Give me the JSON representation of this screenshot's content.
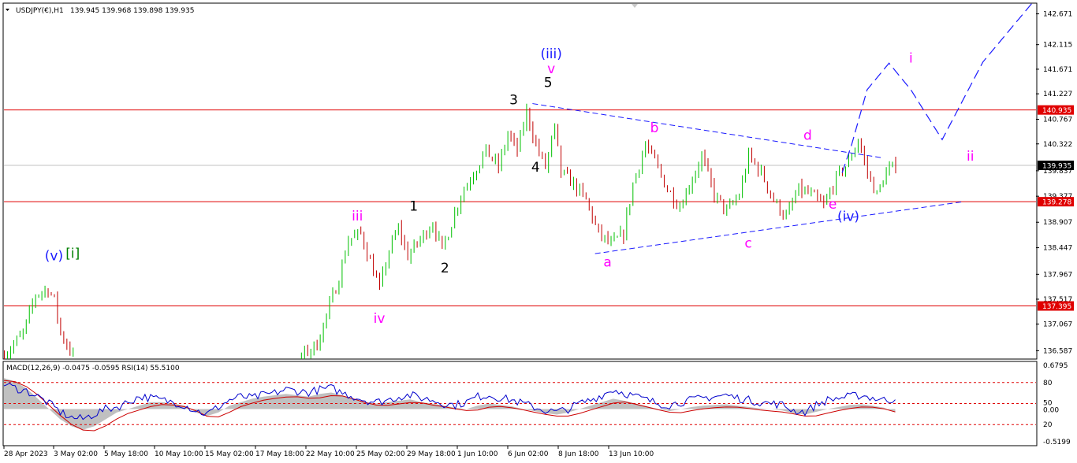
{
  "header": {
    "symbol": "USDJPY(€),H1",
    "ohlc": "139.945 139.968 139.898 139.935"
  },
  "colors": {
    "bull_candle": "#00c000",
    "bear_candle": "#c00000",
    "wick": "#000000",
    "hline": "#e00000",
    "trendline": "#1a1aff",
    "projection": "#1a1aff",
    "label_black": "#000000",
    "label_magenta": "#ff00ff",
    "label_blue": "#1a1aff",
    "label_green": "#008000",
    "macd_hist": "#c0c0c0",
    "rsi_line": "#0000cc",
    "signal_line": "#cc0000"
  },
  "chart_data": [
    {
      "type": "candlestick",
      "symbol": "USDJPY(€)",
      "timeframe": "H1",
      "last_ohlc": {
        "open": 139.945,
        "high": 139.968,
        "low": 139.898,
        "close": 139.935
      },
      "ylim": [
        136.45,
        142.85
      ],
      "y_ticks": [
        "142.671",
        "142.115",
        "141.671",
        "141.227",
        "140.767",
        "140.322",
        "139.837",
        "139.377",
        "138.907",
        "138.447",
        "137.967",
        "137.517",
        "137.067",
        "136.587"
      ],
      "x_ticks": [
        "28 Apr 2023",
        "3 May 02:00",
        "5 May 18:00",
        "10 May 10:00",
        "15 May 02:00",
        "17 May 18:00",
        "22 May 10:00",
        "25 May 02:00",
        "29 May 18:00",
        "1 Jun 10:00",
        "6 Jun 02:00",
        "8 Jun 18:00",
        "13 Jun 10:00"
      ],
      "horizontal_lines": [
        {
          "price": 140.935,
          "label": "140.935"
        },
        {
          "price": 139.278,
          "label": "139.278"
        },
        {
          "price": 137.395,
          "label": "137.395"
        }
      ],
      "gray_line": {
        "price": 139.935,
        "label": "139.935"
      },
      "price_path": [
        [
          0,
          136.5
        ],
        [
          6,
          136.9
        ],
        [
          10,
          137.6
        ],
        [
          14,
          137.7
        ],
        [
          16,
          137.5
        ],
        [
          18,
          136.9
        ],
        [
          22,
          136.5
        ],
        [
          95,
          136.5
        ],
        [
          100,
          136.7
        ],
        [
          104,
          137.4
        ],
        [
          107,
          137.9
        ],
        [
          110,
          138.6
        ],
        [
          114,
          138.7
        ],
        [
          117,
          138.2
        ],
        [
          120,
          137.7
        ],
        [
          123,
          138.4
        ],
        [
          126,
          138.8
        ],
        [
          129,
          138.3
        ],
        [
          133,
          138.6
        ],
        [
          137,
          138.9
        ],
        [
          140,
          138.4
        ],
        [
          143,
          138.9
        ],
        [
          146,
          139.4
        ],
        [
          150,
          139.8
        ],
        [
          154,
          140.2
        ],
        [
          158,
          139.9
        ],
        [
          161,
          140.5
        ],
        [
          164,
          140.2
        ],
        [
          167,
          140.9
        ],
        [
          170,
          140.3
        ],
        [
          173,
          139.9
        ],
        [
          176,
          140.6
        ],
        [
          178,
          139.8
        ],
        [
          182,
          139.6
        ],
        [
          186,
          139.3
        ],
        [
          190,
          138.7
        ],
        [
          194,
          138.5
        ],
        [
          198,
          138.7
        ],
        [
          201,
          139.6
        ],
        [
          205,
          140.3
        ],
        [
          208,
          140.0
        ],
        [
          212,
          139.5
        ],
        [
          216,
          139.2
        ],
        [
          220,
          139.7
        ],
        [
          223,
          140.1
        ],
        [
          227,
          139.4
        ],
        [
          231,
          139.1
        ],
        [
          235,
          139.4
        ],
        [
          238,
          140.1
        ],
        [
          242,
          139.8
        ],
        [
          246,
          139.3
        ],
        [
          250,
          139.0
        ],
        [
          254,
          139.5
        ],
        [
          258,
          139.4
        ],
        [
          262,
          139.2
        ],
        [
          266,
          139.7
        ],
        [
          270,
          140.0
        ],
        [
          273,
          140.4
        ],
        [
          276,
          139.8
        ],
        [
          279,
          139.4
        ],
        [
          282,
          139.8
        ],
        [
          285,
          139.94
        ]
      ],
      "wave_labels": [
        {
          "text": "(v)",
          "price": 138.22,
          "bar": 16,
          "color": "blue"
        },
        {
          "text": "[i]",
          "price": 138.26,
          "bar": 22,
          "color": "green"
        },
        {
          "text": "iii",
          "price": 138.94,
          "bar": 113,
          "color": "magenta"
        },
        {
          "text": "iv",
          "price": 137.09,
          "bar": 120,
          "color": "magenta"
        },
        {
          "text": "1",
          "price": 139.12,
          "bar": 131,
          "color": "black"
        },
        {
          "text": "2",
          "price": 138.0,
          "bar": 141,
          "color": "black"
        },
        {
          "text": "3",
          "price": 141.04,
          "bar": 163,
          "color": "black"
        },
        {
          "text": "4",
          "price": 139.82,
          "bar": 170,
          "color": "black"
        },
        {
          "text": "5",
          "price": 141.35,
          "bar": 174,
          "color": "black"
        },
        {
          "text": "v",
          "price": 141.6,
          "bar": 175,
          "color": "magenta"
        },
        {
          "text": "(iii)",
          "price": 141.87,
          "bar": 175,
          "color": "blue"
        },
        {
          "text": "a",
          "price": 138.11,
          "bar": 193,
          "color": "magenta"
        },
        {
          "text": "b",
          "price": 140.53,
          "bar": 208,
          "color": "magenta"
        },
        {
          "text": "c",
          "price": 138.45,
          "bar": 238,
          "color": "magenta"
        },
        {
          "text": "d",
          "price": 140.4,
          "bar": 257,
          "color": "magenta"
        },
        {
          "text": "e",
          "price": 139.15,
          "bar": 265,
          "color": "magenta"
        },
        {
          "text": "(iv)",
          "price": 138.93,
          "bar": 270,
          "color": "blue"
        },
        {
          "text": "i",
          "price": 141.79,
          "bar": 290,
          "color": "magenta"
        },
        {
          "text": "ii",
          "price": 140.02,
          "bar": 309,
          "color": "magenta"
        }
      ],
      "trendlines": [
        {
          "from": [
            169,
            141.05
          ],
          "to": [
            281,
            140.07
          ],
          "style": "dashed"
        },
        {
          "from": [
            189,
            138.34
          ],
          "to": [
            307,
            139.28
          ],
          "style": "dashed"
        }
      ],
      "projection": [
        [
          268,
          139.8
        ],
        [
          271,
          140.3
        ],
        [
          276,
          141.3
        ],
        [
          283,
          141.78
        ],
        [
          290,
          141.3
        ],
        [
          300,
          140.4
        ],
        [
          313,
          141.8
        ],
        [
          330,
          142.95
        ]
      ]
    },
    {
      "type": "line",
      "title": "MACD(12,26,9) -0.0475 -0.0595 RSI(14) 55.5100",
      "ylim": [
        -0.5199,
        0.6795
      ],
      "y_ticks_right": [
        "0.6795",
        "80",
        "50",
        "0.00",
        "20",
        "-0.5199"
      ],
      "levels": [
        80,
        50,
        20
      ],
      "series": [
        {
          "name": "RSI(14)",
          "role": "rsi",
          "values": [
            78,
            72,
            68,
            60,
            50,
            38,
            30,
            28,
            35,
            42,
            45,
            52,
            60,
            58,
            55,
            52,
            48,
            40,
            35,
            45,
            55,
            60,
            58,
            62,
            65,
            70,
            68,
            66,
            70,
            72,
            65,
            60,
            55,
            52,
            55,
            60,
            62,
            58,
            55,
            50,
            48,
            52,
            60,
            62,
            58,
            55,
            50,
            45,
            40,
            38,
            42,
            50,
            55,
            62,
            70,
            65,
            60,
            55,
            50,
            48,
            52,
            55,
            58,
            60,
            62,
            58,
            55,
            52,
            50,
            48,
            40,
            38,
            48,
            55,
            58,
            60,
            62,
            58,
            55,
            55.51
          ]
        },
        {
          "name": "MACD",
          "role": "histogram",
          "values": [
            0.45,
            0.4,
            0.3,
            0.15,
            0.0,
            -0.15,
            -0.25,
            -0.3,
            -0.25,
            -0.15,
            -0.05,
            0.0,
            0.05,
            0.1,
            0.1,
            0.08,
            0.05,
            -0.05,
            -0.1,
            -0.05,
            0.05,
            0.1,
            0.15,
            0.18,
            0.2,
            0.22,
            0.2,
            0.18,
            0.22,
            0.24,
            0.2,
            0.15,
            0.1,
            0.08,
            0.1,
            0.12,
            0.14,
            0.1,
            0.08,
            0.05,
            0.02,
            0.0,
            0.05,
            0.08,
            0.06,
            0.04,
            0.0,
            -0.03,
            -0.06,
            -0.08,
            -0.05,
            0.0,
            0.05,
            0.1,
            0.15,
            0.12,
            0.08,
            0.04,
            0.0,
            -0.03,
            0.0,
            0.03,
            0.05,
            0.06,
            0.07,
            0.05,
            0.03,
            0.01,
            0.0,
            -0.02,
            -0.06,
            -0.08,
            -0.04,
            0.0,
            0.03,
            0.06,
            0.07,
            0.05,
            0.02,
            -0.0475
          ]
        }
      ]
    }
  ]
}
